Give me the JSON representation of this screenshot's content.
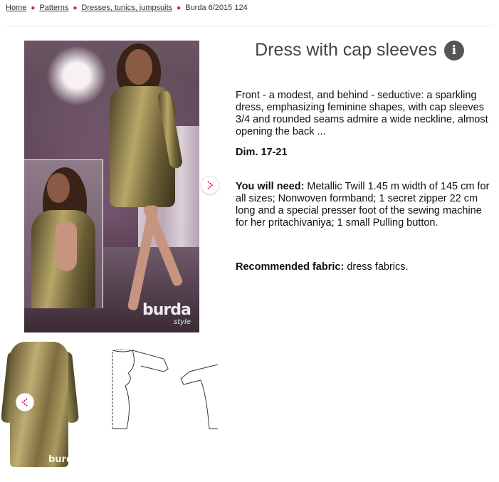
{
  "breadcrumb": {
    "home": "Home",
    "patterns": "Patterns",
    "category": "Dresses, tunics, jumpsuits",
    "current": "Burda 6/2015 124"
  },
  "product": {
    "title": "Dress with cap sleeves",
    "info_icon": "i",
    "description": "Front - a modest, and behind - seductive: a sparkling dress, emphasizing feminine shapes, with cap sleeves 3/4 and rounded seams admire a wide neckline, almost opening the back ...",
    "dimensions": "Dim. 17-21",
    "you_will_need_label": "You will need:",
    "you_will_need_text": " Metallic Twill 1.45 m width of 145 cm for all sizes; Nonwoven formband; 1 secret zipper 22 cm long and a special presser foot of the sewing machine for her pritachivaniya; 1 small Pulling button.",
    "fabric_label": "Recommended fabric:",
    "fabric_text": " dress fabrics."
  },
  "gallery": {
    "logo_main": "burda",
    "logo_sub": "style",
    "logo_thumb": "burda",
    "next_icon": "chevron-right-icon",
    "prev_icon": "chevron-left-icon"
  },
  "colors": {
    "accent": "#d6184f",
    "title": "#444444",
    "info_badge": "#555555"
  }
}
